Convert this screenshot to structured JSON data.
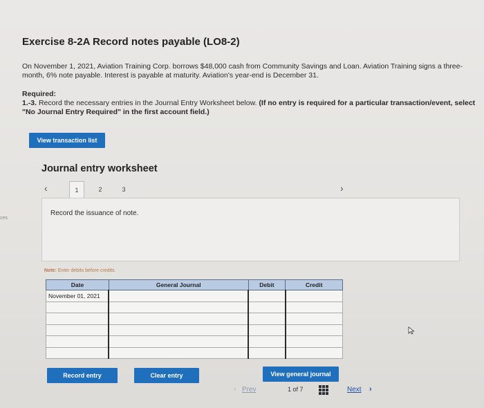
{
  "left_stub": "ces",
  "exercise": {
    "title": "Exercise 8-2A Record notes payable (LO8-2)",
    "description": "On November 1, 2021, Aviation Training Corp. borrows $48,000 cash from Community Savings and Loan. Aviation Training signs a three-month, 6% note payable. Interest is payable at maturity. Aviation's year-end is December 31.",
    "required_heading": "Required:",
    "required_prefix": "1.-3.",
    "required_text": "Record the necessary entries in the Journal Entry Worksheet below.",
    "required_bold": "(If no entry is required for a particular transaction/event, select \"No Journal Entry Required\" in the first account field.)"
  },
  "buttons": {
    "view_transaction_list": "View transaction list",
    "record_entry": "Record entry",
    "clear_entry": "Clear entry",
    "view_general_journal": "View general journal"
  },
  "worksheet": {
    "title": "Journal entry worksheet",
    "tabs": [
      "1",
      "2",
      "3"
    ],
    "active_tab": "1",
    "prompt": "Record the issuance of note.",
    "note_label": "Note:",
    "note_text": "Enter debits before credits."
  },
  "journal_table": {
    "headers": [
      "Date",
      "General Journal",
      "Debit",
      "Credit"
    ],
    "first_row_date": "November 01, 2021"
  },
  "pager": {
    "prev": "Prev",
    "position": "1 of 7",
    "next": "Next"
  },
  "colors": {
    "accent": "#1f6fbd",
    "table_header": "#b9cae3",
    "note_text": "#b9774a"
  }
}
